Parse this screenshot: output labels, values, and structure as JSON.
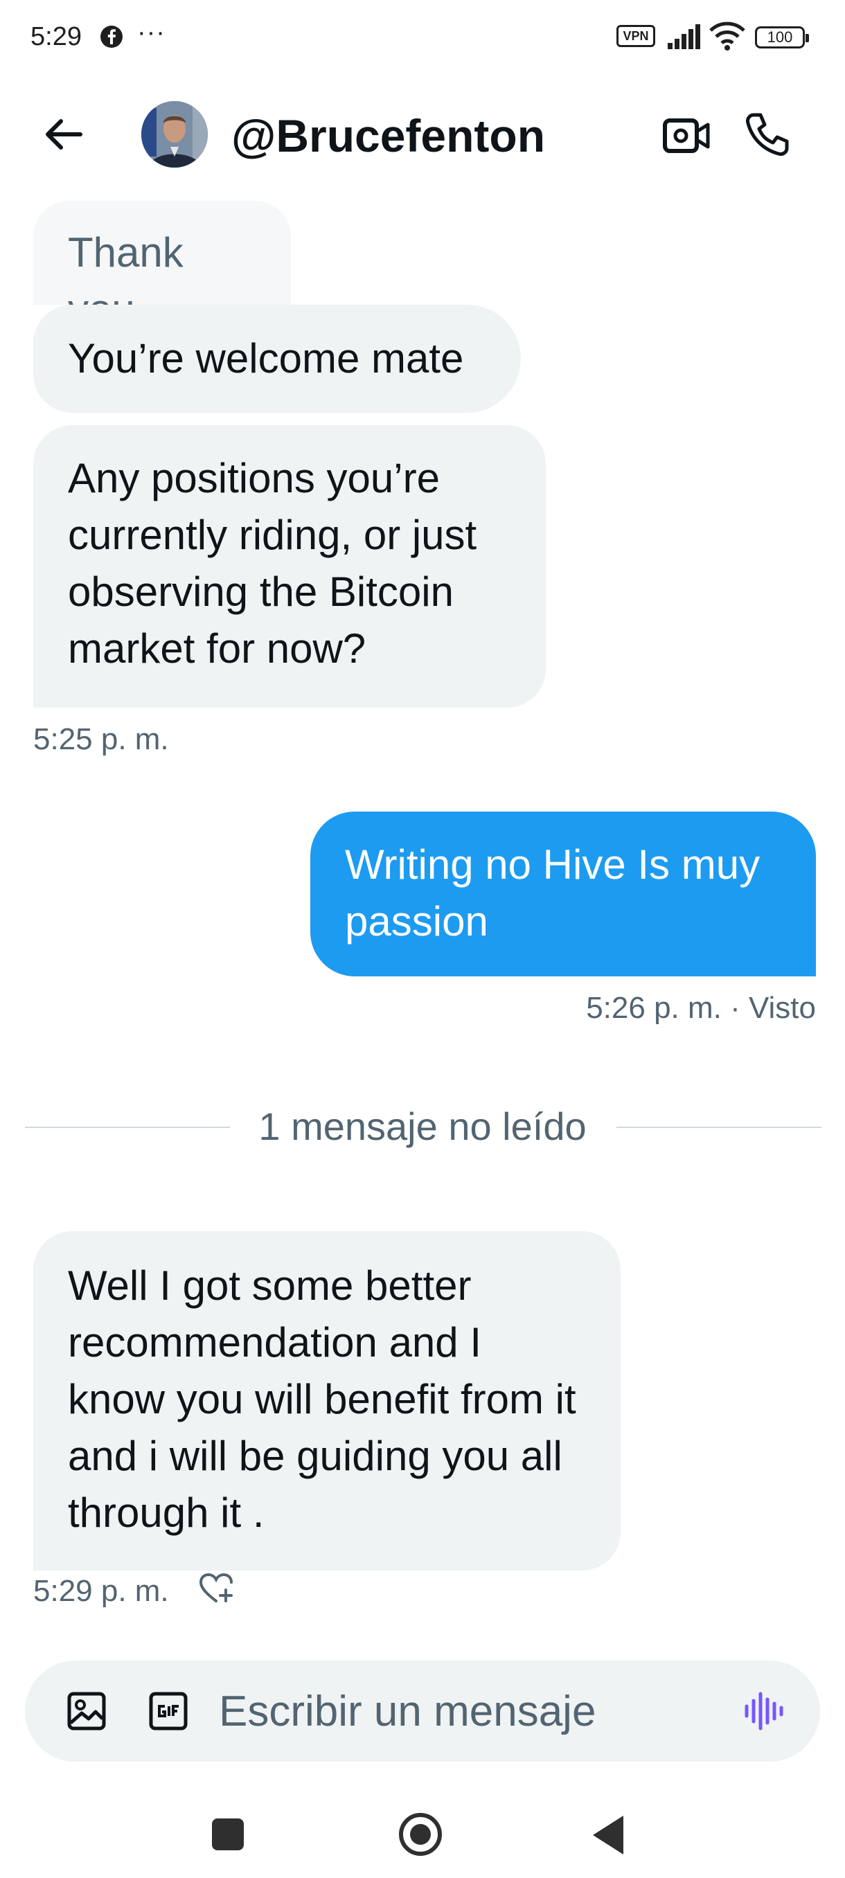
{
  "status_bar": {
    "time": "5:29",
    "dots": "···",
    "vpn_label": "VPN",
    "battery_level": "100"
  },
  "header": {
    "username": "@Brucefenton"
  },
  "messages": [
    {
      "direction": "in",
      "text": "Thank you"
    },
    {
      "direction": "in",
      "text": "You’re welcome mate"
    },
    {
      "direction": "in",
      "text": "Any positions you’re currently riding, or just observing the Bitcoin market for now?"
    },
    {
      "direction": "out",
      "text": "Writing no Hive Is muy passion"
    },
    {
      "direction": "in",
      "text": "Well I got some better recommendation and I know you will benefit from it and i will be guiding you all through it ."
    }
  ],
  "meta": {
    "first_time": "5:25 p. m.",
    "sent_status": "5:26 p. m. · Visto",
    "last_time": "5:29 p. m."
  },
  "divider": {
    "label": "1 mensaje no leído"
  },
  "composer": {
    "placeholder": "Escribir un mensaje",
    "value": ""
  },
  "colors": {
    "accent": "#1d9bf0",
    "incoming_bubble": "#eff3f4",
    "secondary_text": "#536471",
    "voice_icon": "#7856ff"
  },
  "icons": {
    "back": "arrow-left-icon",
    "video": "video-camera-icon",
    "call": "phone-icon",
    "media": "image-icon",
    "gif": "gif-icon",
    "voice": "voice-waveform-icon",
    "reaction": "heart-plus-icon"
  }
}
